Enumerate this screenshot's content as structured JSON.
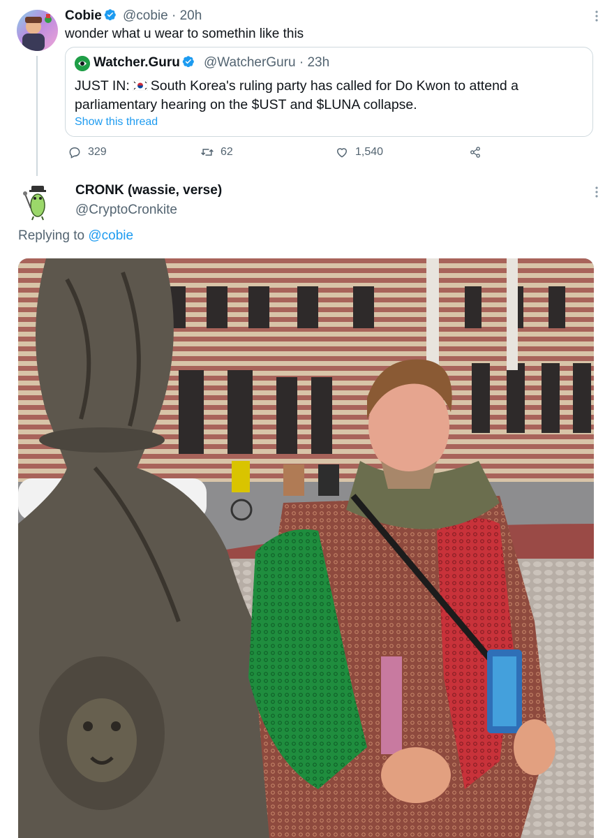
{
  "tweet": {
    "author_name": "Cobie",
    "author_handle": "@cobie",
    "time": "· 20h",
    "text": "wonder what u wear to somethin like this",
    "avatar_icon": "user-avatar",
    "verified_icon": "verified-badge-icon"
  },
  "quote": {
    "author_name": "Watcher.Guru",
    "author_handle": "@WatcherGuru",
    "time": "· 23h",
    "text_prefix": "JUST IN:",
    "flag_icon": "south-korea-flag-icon",
    "text_body": "South Korea's ruling party has called for Do Kwon to attend a parliamentary hearing on the $UST and $LUNA collapse.",
    "show_thread": "Show this thread"
  },
  "actions": {
    "replies": "329",
    "retweets": "62",
    "likes": "1,540",
    "share_icon": "share-icon"
  },
  "reply": {
    "author_name": "CRONK (wassie, verse)",
    "author_handle": "@CryptoCronkite",
    "replying_prefix": "Replying to",
    "replying_to": "@cobie",
    "photo_icon": "attached-photo"
  },
  "colors": {
    "accent": "#1d9bf0",
    "secondary_text": "#536471",
    "border": "#cfd9de"
  }
}
